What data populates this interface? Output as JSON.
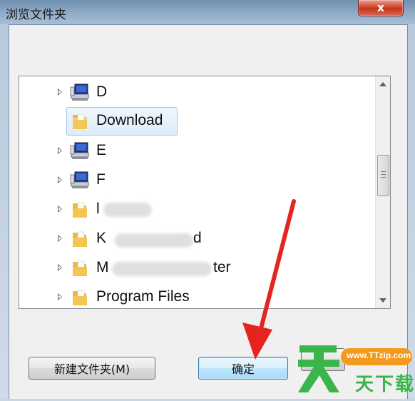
{
  "window": {
    "title": "浏览文件夹",
    "close_label": "x"
  },
  "tree": {
    "items": [
      {
        "label": "D",
        "icon": "computer-drive-icon",
        "selected": false
      },
      {
        "label": "Download",
        "icon": "folder-icon",
        "selected": true
      },
      {
        "label": "E",
        "icon": "computer-drive-icon",
        "selected": false
      },
      {
        "label": "F",
        "icon": "computer-drive-icon",
        "selected": false
      },
      {
        "label": "l",
        "icon": "folder-icon",
        "selected": false
      },
      {
        "label": "K",
        "label_tail": "d",
        "icon": "folder-icon",
        "selected": false
      },
      {
        "label": "M",
        "label_tail": "ter",
        "icon": "folder-icon",
        "selected": false
      },
      {
        "label": "Program Files",
        "icon": "folder-icon",
        "selected": false
      }
    ]
  },
  "buttons": {
    "new_folder": "新建文件夹(M)",
    "ok": "确定"
  },
  "watermark": {
    "url": "www.TTzip.com",
    "text": "天下载"
  },
  "colors": {
    "selection_border": "#9cc7ef",
    "arrow": "#e52420",
    "watermark_green": "#39b54a",
    "watermark_orange": "#f39a1e"
  }
}
